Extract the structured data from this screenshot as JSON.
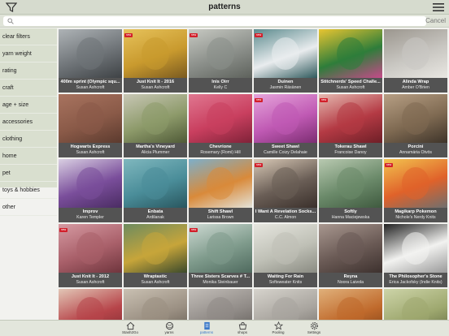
{
  "header": {
    "title": "patterns",
    "filter_icon": "filter-icon",
    "menu_icon": "hamburger-menu-icon"
  },
  "search": {
    "placeholder": "",
    "cancel_label": "Cancel"
  },
  "sidebar": {
    "items": [
      {
        "label": "clear filters"
      },
      {
        "label": "yarn weight"
      },
      {
        "label": "rating"
      },
      {
        "label": "craft"
      },
      {
        "label": "age + size"
      },
      {
        "label": "accessories"
      },
      {
        "label": "clothing"
      },
      {
        "label": "home"
      },
      {
        "label": "pet"
      },
      {
        "label": "toys & hobbies"
      },
      {
        "label": "other"
      }
    ]
  },
  "patterns": [
    {
      "name": "400m sprint (Olympic squ...",
      "designer": "Susan Ashcroft",
      "badge": false,
      "colors": [
        "#6f7478",
        "#aeb3b6",
        "#3e4245"
      ]
    },
    {
      "name": "Just Knit It - 2016",
      "designer": "Susan Ashcroft",
      "badge": true,
      "colors": [
        "#c99a2e",
        "#e6c25b",
        "#7a5a20"
      ]
    },
    {
      "name": "Inis Oirr",
      "designer": "Kelly C",
      "badge": true,
      "colors": [
        "#8b8f8a",
        "#c7c9c2",
        "#5e625c"
      ]
    },
    {
      "name": "Duinen",
      "designer": "Jasmin Räsänen",
      "badge": true,
      "colors": [
        "#e9ecee",
        "#5c8b8e",
        "#2f5a5d"
      ]
    },
    {
      "name": "Stitchnerds' Speed Challe...",
      "designer": "Susan Ashcroft",
      "badge": false,
      "colors": [
        "#2e7d3a",
        "#e8c531",
        "#c64a8a"
      ]
    },
    {
      "name": "Alinda Wrap",
      "designer": "Amber O'Brien",
      "badge": false,
      "colors": [
        "#c9c7c2",
        "#9b968e",
        "#e9e7e2"
      ]
    },
    {
      "name": "Hogwarts Express",
      "designer": "Susan Ashcroft",
      "badge": false,
      "colors": [
        "#8a5a48",
        "#a8735f",
        "#5b3a2e"
      ]
    },
    {
      "name": "Martha's Vineyard",
      "designer": "Alicia Plummer",
      "badge": false,
      "colors": [
        "#8d9a6a",
        "#c8c7b5",
        "#4f5a37"
      ]
    },
    {
      "name": "Chevrione",
      "designer": "Rosemary (Romi) Hill",
      "badge": false,
      "colors": [
        "#c93f5f",
        "#e07790",
        "#7f2238"
      ]
    },
    {
      "name": "Sweet Shawl",
      "designer": "Camille Coizy Delahaie",
      "badge": true,
      "colors": [
        "#c05ab4",
        "#e6a5db",
        "#7c2d72"
      ]
    },
    {
      "name": "Tokerau Shawl",
      "designer": "Francoise Danoy",
      "badge": true,
      "colors": [
        "#b43a44",
        "#e5b9b0",
        "#6e1f27"
      ]
    },
    {
      "name": "Porcini",
      "designer": "Annamária Ötvös",
      "badge": false,
      "colors": [
        "#7f6a52",
        "#b79f84",
        "#3e342a"
      ]
    },
    {
      "name": "Improv",
      "designer": "Karen Templer",
      "badge": false,
      "colors": [
        "#7a4e9b",
        "#d9cfe2",
        "#4a2c62"
      ]
    },
    {
      "name": "Enbata",
      "designer": "Ardilanak",
      "badge": false,
      "colors": [
        "#4a8d99",
        "#7fb7be",
        "#29565e"
      ]
    },
    {
      "name": "Shift Shawl",
      "designer": "Larissa Brown",
      "badge": false,
      "colors": [
        "#d98a3a",
        "#7dafca",
        "#e3e3d9"
      ]
    },
    {
      "name": "I Want A Revelation Socks...",
      "designer": "C.C. Almon",
      "badge": true,
      "colors": [
        "#6a5e56",
        "#d8c8b5",
        "#3a302b"
      ]
    },
    {
      "name": "Softly",
      "designer": "Hanna Maciejewska",
      "badge": false,
      "colors": [
        "#6b8a6a",
        "#b8c9b0",
        "#3f5a3f"
      ]
    },
    {
      "name": "Magikarp Pokemon",
      "designer": "Nichole's Nerdy Knits",
      "badge": true,
      "colors": [
        "#e0622a",
        "#f2c34f",
        "#6f6f6f"
      ]
    },
    {
      "name": "Just Knit It - 2012",
      "designer": "Susan Ashcroft",
      "badge": true,
      "colors": [
        "#a9606a",
        "#d69aa2",
        "#6f353d"
      ]
    },
    {
      "name": "Wraptastic",
      "designer": "Susan Ashcroft",
      "badge": false,
      "colors": [
        "#c7a53a",
        "#6d8b5f",
        "#3b4a2c"
      ]
    },
    {
      "name": "Three Sisters Scarves # T...",
      "designer": "Monika Steinbauer",
      "badge": true,
      "colors": [
        "#7f9b8c",
        "#cdd9d2",
        "#4f6a5e"
      ]
    },
    {
      "name": "Waiting For Rain",
      "designer": "Softsweater Knits",
      "badge": false,
      "colors": [
        "#bfc0b6",
        "#e6e6df",
        "#8a8b82"
      ]
    },
    {
      "name": "Reyna",
      "designer": "Noora Laivola",
      "badge": false,
      "colors": [
        "#6a5a55",
        "#a8978f",
        "#3d312e"
      ]
    },
    {
      "name": "The Philosopher's Stone",
      "designer": "Erica Jackofsky (Indie Knits)",
      "badge": false,
      "colors": [
        "#f2f2f0",
        "#222222",
        "#9a9a9a"
      ]
    },
    {
      "name": "",
      "designer": "",
      "badge": false,
      "colors": [
        "#b7454a",
        "#e2c6b6",
        "#7a2b30"
      ]
    },
    {
      "name": "",
      "designer": "",
      "badge": false,
      "colors": [
        "#9a8f82",
        "#c9c0b2",
        "#5f574d"
      ]
    },
    {
      "name": "",
      "designer": "",
      "badge": false,
      "colors": [
        "#8f8a86",
        "#c2bdb8",
        "#5a5652"
      ]
    },
    {
      "name": "",
      "designer": "",
      "badge": false,
      "colors": [
        "#a8a49e",
        "#d6d3cc",
        "#6f6b66"
      ]
    },
    {
      "name": "",
      "designer": "",
      "badge": false,
      "colors": [
        "#c06a2c",
        "#e0b07a",
        "#7a3e16"
      ]
    },
    {
      "name": "",
      "designer": "",
      "badge": false,
      "colors": [
        "#9ea86f",
        "#cdd4a8",
        "#5c653e"
      ]
    }
  ],
  "tabbar": {
    "tabs": [
      {
        "label": "Stash2Go",
        "icon": "home-icon",
        "active": false
      },
      {
        "label": "yarns",
        "icon": "yarn-ball-icon",
        "active": false
      },
      {
        "label": "patterns",
        "icon": "pattern-book-icon",
        "active": true
      },
      {
        "label": "shops",
        "icon": "shop-icon",
        "active": false
      },
      {
        "label": "Pooling",
        "icon": "star-icon",
        "active": false
      },
      {
        "label": "Settings",
        "icon": "gear-icon",
        "active": false
      }
    ],
    "badge_label": "new"
  }
}
